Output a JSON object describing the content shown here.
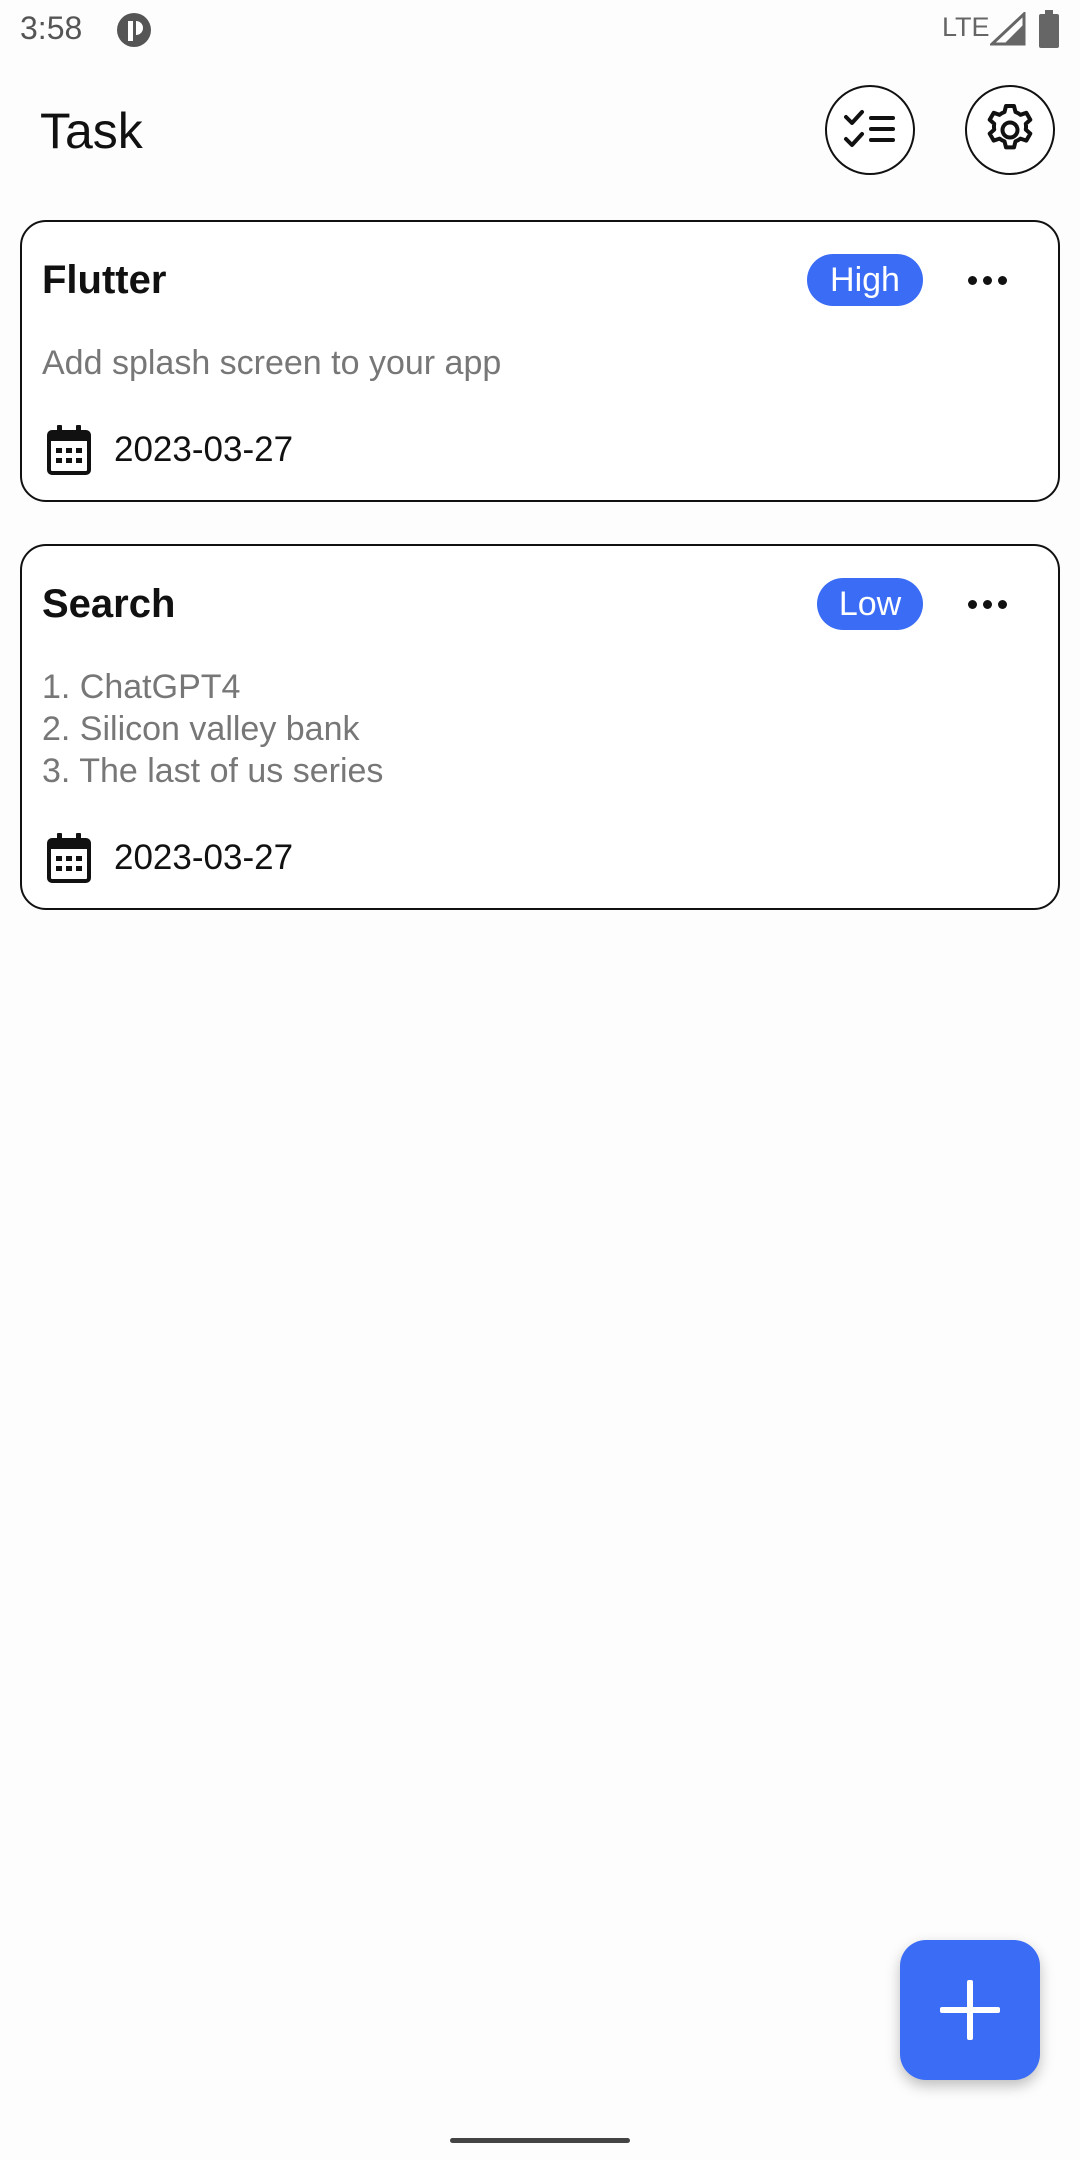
{
  "status_bar": {
    "time": "3:58",
    "network": "LTE",
    "icons": [
      "app-notification-icon",
      "signal-icon",
      "battery-icon"
    ]
  },
  "app_bar": {
    "title": "Task",
    "actions": [
      "checklist-icon",
      "settings-gear-icon"
    ]
  },
  "tasks": [
    {
      "title": "Flutter",
      "priority": "High",
      "description_lines": [
        "Add splash screen to your app"
      ],
      "date": "2023-03-27"
    },
    {
      "title": "Search",
      "priority": "Low",
      "description_lines": [
        "1. ChatGPT4",
        "2. Silicon valley bank",
        "3. The last of us series"
      ],
      "date": "2023-03-27"
    }
  ],
  "fab": {
    "icon": "plus-icon"
  },
  "colors": {
    "accent": "#3a6cf6",
    "text_primary": "#111111",
    "text_secondary": "#777777",
    "background": "#fdfdfd"
  }
}
